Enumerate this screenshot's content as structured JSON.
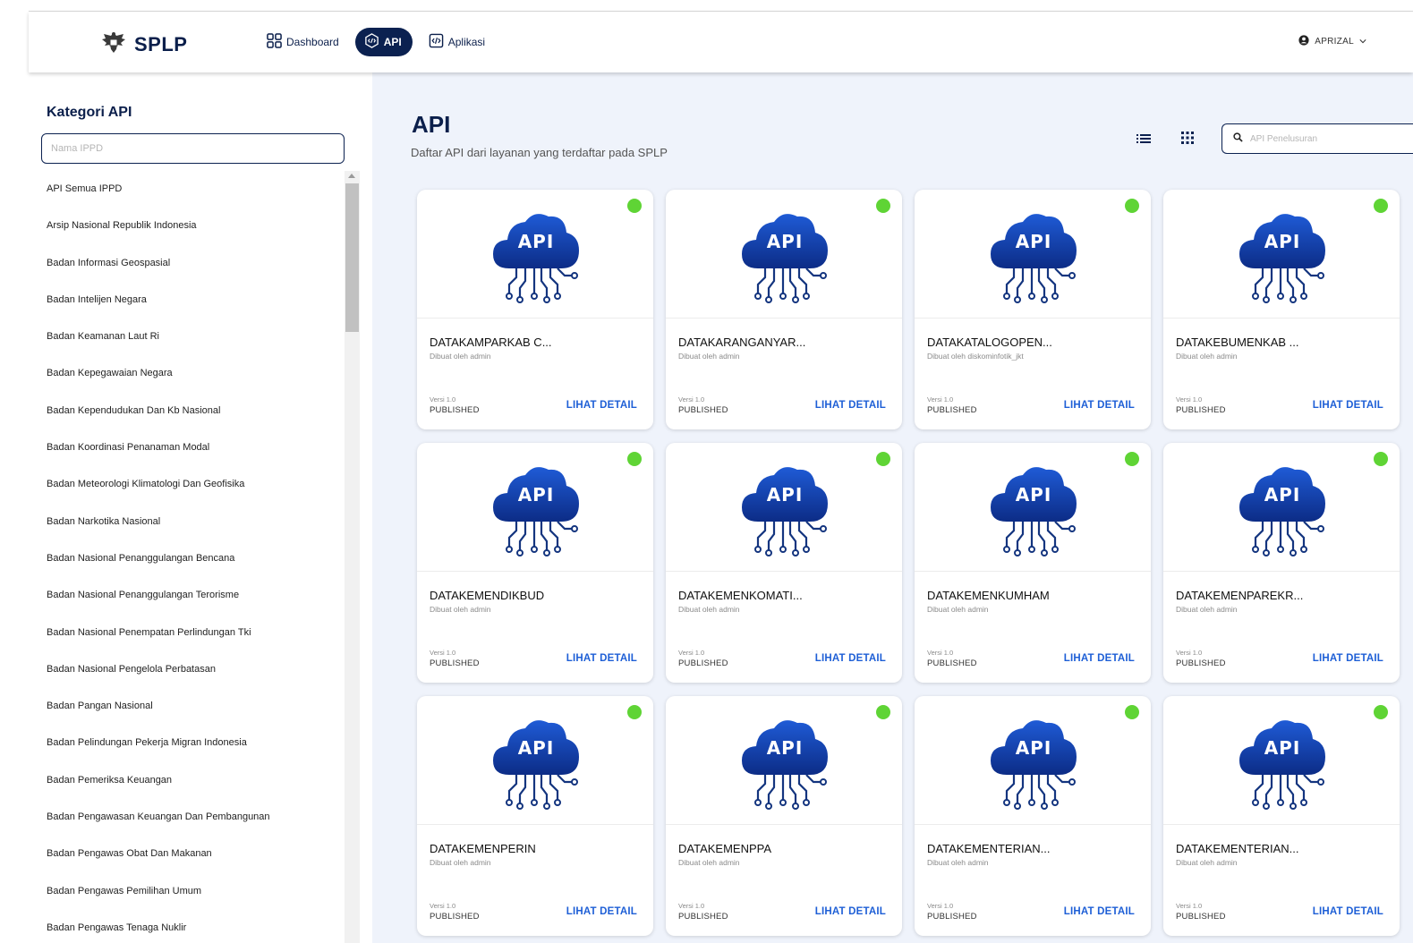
{
  "header": {
    "brand": "SPLP",
    "nav": [
      {
        "label": "Dashboard",
        "icon": "dashboard-icon"
      },
      {
        "label": "API",
        "icon": "api-icon",
        "active": true
      },
      {
        "label": "Aplikasi",
        "icon": "code-file-icon"
      }
    ],
    "user": "APRIZAL"
  },
  "sidebar": {
    "title": "Kategori API",
    "search_placeholder": "Nama IPPD",
    "items": [
      "API Semua IPPD",
      "Arsip Nasional Republik Indonesia",
      "Badan Informasi Geospasial",
      "Badan Intelijen Negara",
      "Badan Keamanan Laut Ri",
      "Badan Kepegawaian Negara",
      "Badan Kependudukan Dan Kb Nasional",
      "Badan Koordinasi Penanaman Modal",
      "Badan Meteorologi Klimatologi Dan Geofisika",
      "Badan Narkotika Nasional",
      "Badan Nasional Penanggulangan Bencana",
      "Badan Nasional Penanggulangan Terorisme",
      "Badan Nasional Penempatan Perlindungan Tki",
      "Badan Nasional Pengelola Perbatasan",
      "Badan Pangan Nasional",
      "Badan Pelindungan Pekerja Migran Indonesia",
      "Badan Pemeriksa Keuangan",
      "Badan Pengawasan Keuangan Dan Pembangunan",
      "Badan Pengawas Obat Dan Makanan",
      "Badan Pengawas Pemilihan Umum",
      "Badan Pengawas Tenaga Nuklir"
    ]
  },
  "main": {
    "title": "API",
    "subtitle": "Daftar API dari layanan yang terdaftar pada SPLP",
    "search_placeholder": "API Penelusuran",
    "status_color": "#5fd435",
    "cards": [
      {
        "name": "DATAKAMPARKAB C...",
        "creator": "Dibuat oleh admin",
        "version": "Versi 1.0",
        "status": "PUBLISHED",
        "action": "LIHAT DETAIL",
        "image_text": "API"
      },
      {
        "name": "DATAKARANGANYAR...",
        "creator": "Dibuat oleh admin",
        "version": "Versi 1.0",
        "status": "PUBLISHED",
        "action": "LIHAT DETAIL",
        "image_text": "API"
      },
      {
        "name": "DATAKATALOGOPEN...",
        "creator": "Dibuat oleh diskominfotik_jkt",
        "version": "Versi 1.0",
        "status": "PUBLISHED",
        "action": "LIHAT DETAIL",
        "image_text": "API"
      },
      {
        "name": "DATAKEBUMENKAB ...",
        "creator": "Dibuat oleh admin",
        "version": "Versi 1.0",
        "status": "PUBLISHED",
        "action": "LIHAT DETAIL",
        "image_text": "API"
      },
      {
        "name": "DATAKEMENDIKBUD",
        "creator": "Dibuat oleh admin",
        "version": "Versi 1.0",
        "status": "PUBLISHED",
        "action": "LIHAT DETAIL",
        "image_text": "API"
      },
      {
        "name": "DATAKEMENKOMATI...",
        "creator": "Dibuat oleh admin",
        "version": "Versi 1.0",
        "status": "PUBLISHED",
        "action": "LIHAT DETAIL",
        "image_text": "API"
      },
      {
        "name": "DATAKEMENKUMHAM",
        "creator": "Dibuat oleh admin",
        "version": "Versi 1.0",
        "status": "PUBLISHED",
        "action": "LIHAT DETAIL",
        "image_text": "API"
      },
      {
        "name": "DATAKEMENPAREKR...",
        "creator": "Dibuat oleh admin",
        "version": "Versi 1.0",
        "status": "PUBLISHED",
        "action": "LIHAT DETAIL",
        "image_text": "API"
      },
      {
        "name": "DATAKEMENPERIN",
        "creator": "Dibuat oleh admin",
        "version": "Versi 1.0",
        "status": "PUBLISHED",
        "action": "LIHAT DETAIL",
        "image_text": "API"
      },
      {
        "name": "DATAKEMENPPA",
        "creator": "Dibuat oleh admin",
        "version": "Versi 1.0",
        "status": "PUBLISHED",
        "action": "LIHAT DETAIL",
        "image_text": "API"
      },
      {
        "name": "DATAKEMENTERIAN...",
        "creator": "Dibuat oleh admin",
        "version": "Versi 1.0",
        "status": "PUBLISHED",
        "action": "LIHAT DETAIL",
        "image_text": "API"
      },
      {
        "name": "DATAKEMENTERIAN...",
        "creator": "Dibuat oleh admin",
        "version": "Versi 1.0",
        "status": "PUBLISHED",
        "action": "LIHAT DETAIL",
        "image_text": "API"
      }
    ]
  }
}
